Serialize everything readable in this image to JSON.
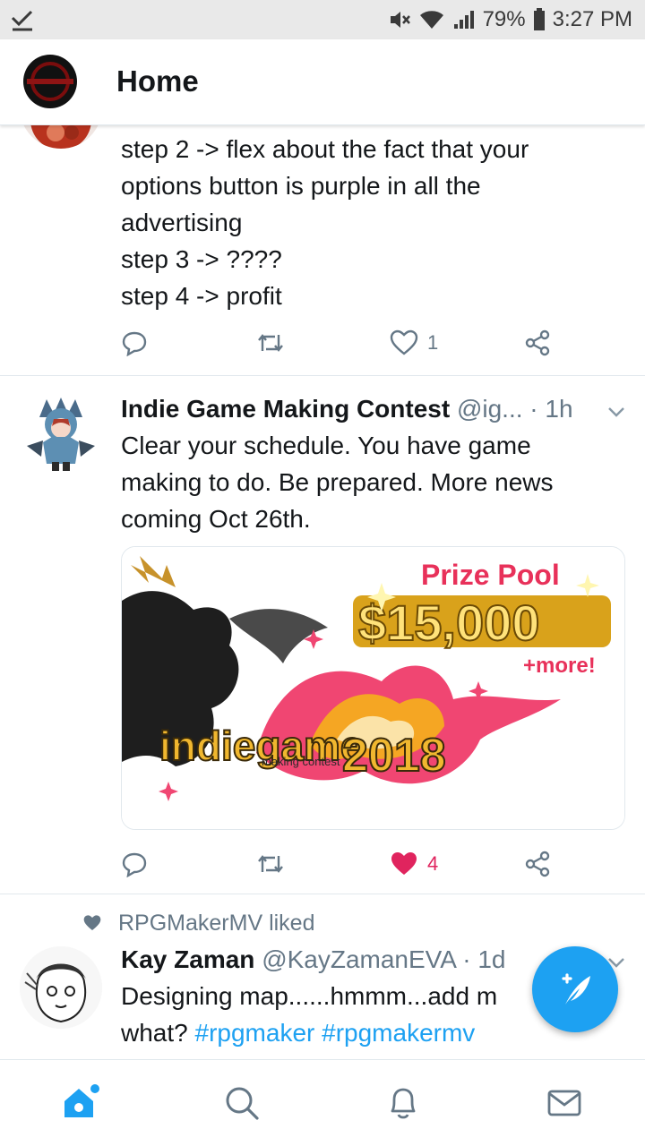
{
  "status_bar": {
    "battery": "79%",
    "time": "3:27 PM"
  },
  "header": {
    "title": "Home"
  },
  "tweets": [
    {
      "text_lines": [
        "step 2 -> flex about the fact that your",
        "options button is purple in all the",
        "advertising",
        "step 3 -> ????",
        "step 4 -> profit"
      ],
      "likes": "1"
    },
    {
      "name": "Indie Game Making Contest",
      "handle": "@ig...",
      "sep": "·",
      "time": "1h",
      "text_lines": [
        "Clear your schedule. You have game",
        "making to do. Be prepared. More news",
        "coming Oct 26th."
      ],
      "media": {
        "prize_title": "Prize Pool",
        "prize_amount": "$15,000",
        "prize_more": "+more!",
        "logo_main": "indiegame",
        "logo_sub": "making contest",
        "logo_year": "2018"
      },
      "likes": "4"
    },
    {
      "liked_by": "RPGMakerMV liked",
      "name": "Kay Zaman",
      "handle": "@KayZamanEVA",
      "sep": "·",
      "time": "1d",
      "text_line1": "Designing map......hmmm...add m",
      "text_line2_plain": "what? ",
      "hashtag1": "#rpgmaker",
      "hashtag2": "#rpgmakermv"
    }
  ],
  "colors": {
    "accent": "#1da1f2",
    "like": "#e0245e",
    "muted": "#657786"
  },
  "icons": [
    "check-download-icon",
    "mute-icon",
    "wifi-icon",
    "signal-icon",
    "battery-icon",
    "reply-icon",
    "retweet-icon",
    "heart-icon",
    "share-icon",
    "caret-down-icon",
    "compose-icon",
    "home-icon",
    "search-icon",
    "notifications-icon",
    "messages-icon"
  ]
}
